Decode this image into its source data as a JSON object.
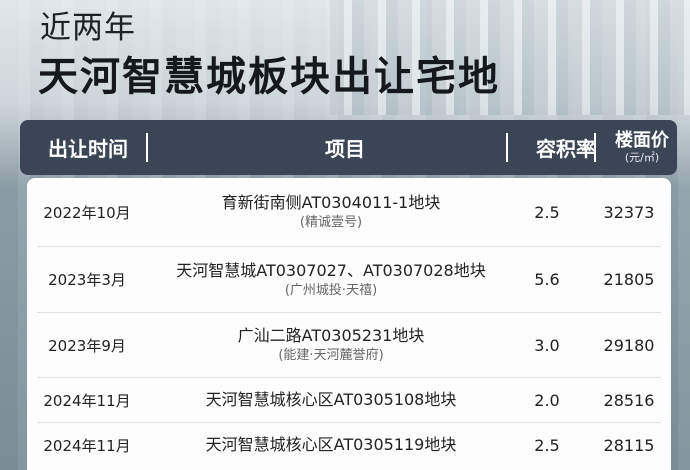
{
  "title": {
    "line1": "近两年",
    "line2": "天河智慧城板块出让宅地"
  },
  "table": {
    "headers": {
      "date": "出让时间",
      "project": "项目",
      "far": "容积率",
      "price": "楼面价",
      "price_unit": "(元/㎡)"
    },
    "rows": [
      {
        "date": "2022年10月",
        "name": "育新街南侧AT0304011-1地块",
        "sub": "(精诚壹号)",
        "far": "2.5",
        "price": "32373"
      },
      {
        "date": "2023年3月",
        "name": "天河智慧城AT0307027、AT0307028地块",
        "sub": "(广州城投·天禧)",
        "far": "5.6",
        "price": "21805"
      },
      {
        "date": "2023年9月",
        "name": "广汕二路AT0305231地块",
        "sub": "(能建·天河麓誉府)",
        "far": "3.0",
        "price": "29180"
      },
      {
        "date": "2024年11月",
        "name": "天河智慧城核心区AT0305108地块",
        "sub": "",
        "far": "2.0",
        "price": "28516"
      },
      {
        "date": "2024年11月",
        "name": "天河智慧城核心区AT0305119地块",
        "sub": "",
        "far": "2.5",
        "price": "28115"
      }
    ]
  }
}
